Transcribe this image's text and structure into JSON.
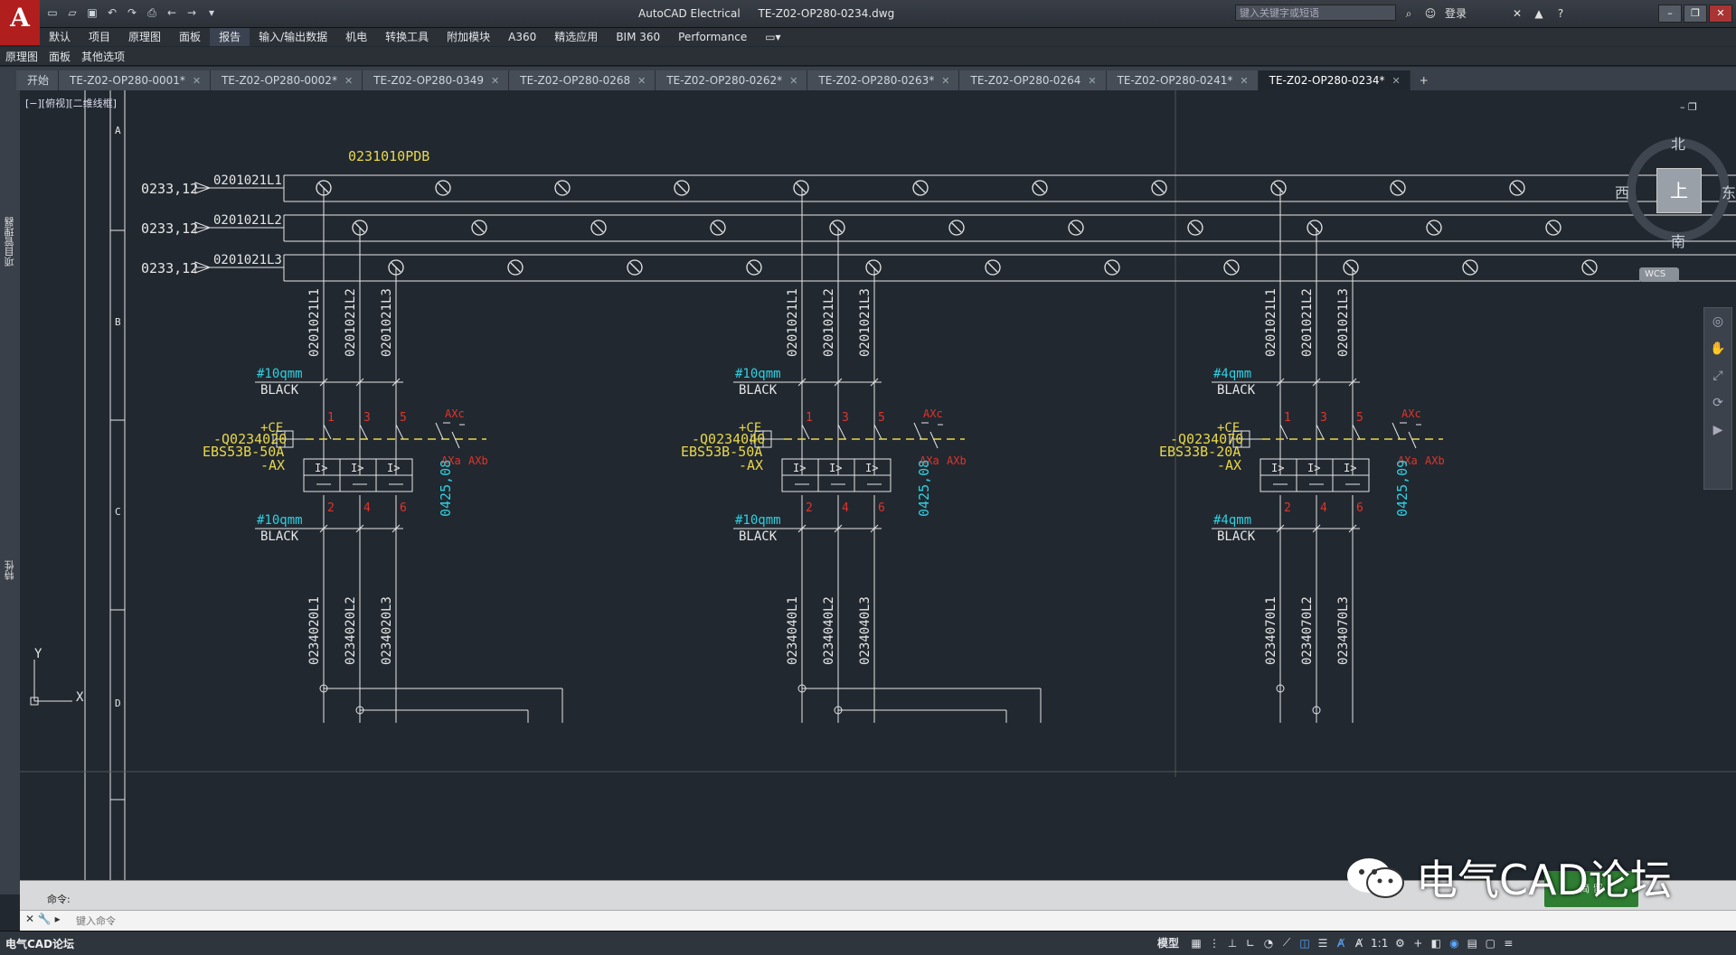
{
  "titlebar": {
    "app_logo": "A",
    "app_name": "AutoCAD Electrical",
    "file_name": "TE-Z02-OP280-0234.dwg",
    "search_placeholder": "键入关键字或短语",
    "login_label": "登录",
    "help_label": "?"
  },
  "menu": [
    "默认",
    "项目",
    "原理图",
    "面板",
    "报告",
    "输入/输出数据",
    "机电",
    "转换工具",
    "附加模块",
    "A360",
    "精选应用",
    "BIM 360",
    "Performance"
  ],
  "menu_active_index": 4,
  "ribbon_row": [
    "原理图",
    "面板",
    "其他选项"
  ],
  "doc_tabs": [
    {
      "label": "开始"
    },
    {
      "label": "TE-Z02-OP280-0001*"
    },
    {
      "label": "TE-Z02-OP280-0002*"
    },
    {
      "label": "TE-Z02-OP280-0349"
    },
    {
      "label": "TE-Z02-OP280-0268"
    },
    {
      "label": "TE-Z02-OP280-0262*"
    },
    {
      "label": "TE-Z02-OP280-0263*"
    },
    {
      "label": "TE-Z02-OP280-0264"
    },
    {
      "label": "TE-Z02-OP280-0241*"
    },
    {
      "label": "TE-Z02-OP280-0234*"
    }
  ],
  "active_tab_index": 9,
  "left_strip": {
    "project_manager": "项目管理器",
    "properties": "特性"
  },
  "viewport": {
    "label": "[−][俯视][二维线框]",
    "viewcube": {
      "north": "北",
      "south": "南",
      "east": "东",
      "west": "西",
      "top": "上"
    },
    "wcs": "WCS",
    "axis_x": "X",
    "axis_y": "Y"
  },
  "drawing": {
    "bus_label": "0231010PDB",
    "row_refs": [
      "A",
      "B",
      "C",
      "D"
    ],
    "bus_lines": [
      {
        "ref": "0233,12",
        "name": "0201021L1"
      },
      {
        "ref": "0233,12",
        "name": "0201021L2"
      },
      {
        "ref": "0233,12",
        "name": "0201021L3"
      }
    ],
    "groups": [
      {
        "top_wires": [
          "0201021L1",
          "0201021L2",
          "0201021L3"
        ],
        "wire_spec_top": "#10qmm",
        "wire_color_top": "BLACK",
        "location": "+CE",
        "tag": "-Q0234020",
        "model": "EBS53B-50A",
        "install": "-AX",
        "pins_top": [
          "1",
          "3",
          "5"
        ],
        "pins_bottom": [
          "2",
          "4",
          "6"
        ],
        "aux": [
          "AXc",
          "AXa",
          "AXb"
        ],
        "xref": "0425,08",
        "wire_spec_bottom": "#10qmm",
        "wire_color_bottom": "BLACK",
        "bottom_wires": [
          "0234020L1",
          "0234020L2",
          "0234020L3"
        ]
      },
      {
        "top_wires": [
          "0201021L1",
          "0201021L2",
          "0201021L3"
        ],
        "wire_spec_top": "#10qmm",
        "wire_color_top": "BLACK",
        "location": "+CE",
        "tag": "-Q0234040",
        "model": "EBS53B-50A",
        "install": "-AX",
        "pins_top": [
          "1",
          "3",
          "5"
        ],
        "pins_bottom": [
          "2",
          "4",
          "6"
        ],
        "aux": [
          "AXc",
          "AXa",
          "AXb"
        ],
        "xref": "0425,08",
        "wire_spec_bottom": "#10qmm",
        "wire_color_bottom": "BLACK",
        "bottom_wires": [
          "0234040L1",
          "0234040L2",
          "0234040L3"
        ]
      },
      {
        "top_wires": [
          "0201021L1",
          "0201021L2",
          "0201021L3"
        ],
        "wire_spec_top": "#4qmm",
        "wire_color_top": "BLACK",
        "location": "+CE",
        "tag": "-Q0234070",
        "model": "EBS33B-20A",
        "install": "-AX",
        "pins_top": [
          "1",
          "3",
          "5"
        ],
        "pins_bottom": [
          "2",
          "4",
          "6"
        ],
        "aux": [
          "AXc",
          "AXa",
          "AXb"
        ],
        "xref": "0425,09",
        "wire_spec_bottom": "#4qmm",
        "wire_color_bottom": "BLACK",
        "bottom_wires": [
          "0234070L1",
          "0234070L2",
          "0234070L3"
        ]
      }
    ]
  },
  "command": {
    "history_label": "命令:",
    "input_placeholder": "键入命令"
  },
  "statusbar": {
    "watermark_small": "电气CAD论坛",
    "model_label": "模型",
    "scale": "1:1"
  },
  "watermark": {
    "text": "电气CAD论坛",
    "badge": "简 留"
  },
  "colors": {
    "background": "#212830",
    "white_line": "#e6e6e6",
    "cyan": "#2fd0e0",
    "yellow": "#e8d84a",
    "red": "#e0342c"
  }
}
